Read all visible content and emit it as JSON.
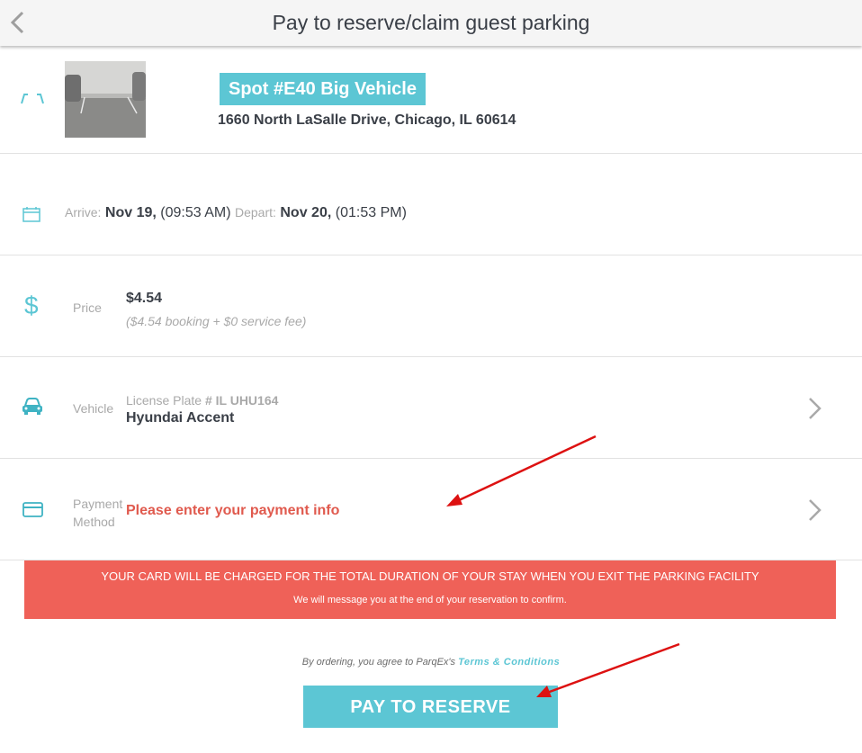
{
  "header": {
    "title": "Pay to reserve/claim guest parking"
  },
  "spot": {
    "badge": "Spot #E40 Big Vehicle",
    "address": "1660 North LaSalle Drive, Chicago, IL 60614",
    "icon": "parking-spot-icon"
  },
  "dates": {
    "arrive_label": "Arrive:",
    "arrive_date": "Nov 19,",
    "arrive_time": "(09:53 AM)",
    "depart_label": "Depart:",
    "depart_date": "Nov 20,",
    "depart_time": "(01:53 PM)",
    "icon": "calendar-icon"
  },
  "price": {
    "label": "Price",
    "value": "$4.54",
    "breakdown": "($4.54 booking + $0 service fee)",
    "icon": "dollar-icon"
  },
  "vehicle": {
    "label": "Vehicle",
    "plate_prefix": "License Plate",
    "plate_value": "# IL UHU164",
    "name": "Hyundai Accent",
    "icon": "car-icon"
  },
  "payment": {
    "label_line1": "Payment",
    "label_line2": "Method",
    "prompt": "Please enter your payment info",
    "icon": "credit-card-icon"
  },
  "notice": {
    "line1": "YOUR CARD WILL BE CHARGED FOR THE TOTAL DURATION OF YOUR STAY WHEN YOU EXIT THE PARKING FACILITY",
    "line2": "We will message you at the end of your reservation to confirm."
  },
  "terms": {
    "prefix": "By ordering, you agree to ParqEx's",
    "link": "Terms & Conditions"
  },
  "action": {
    "pay_label": "PAY TO RESERVE"
  },
  "colors": {
    "accent": "#5cc6d4",
    "alert": "#ef6158",
    "prompt_red": "#e05a4e",
    "annotation_arrow": "#dd1111"
  }
}
